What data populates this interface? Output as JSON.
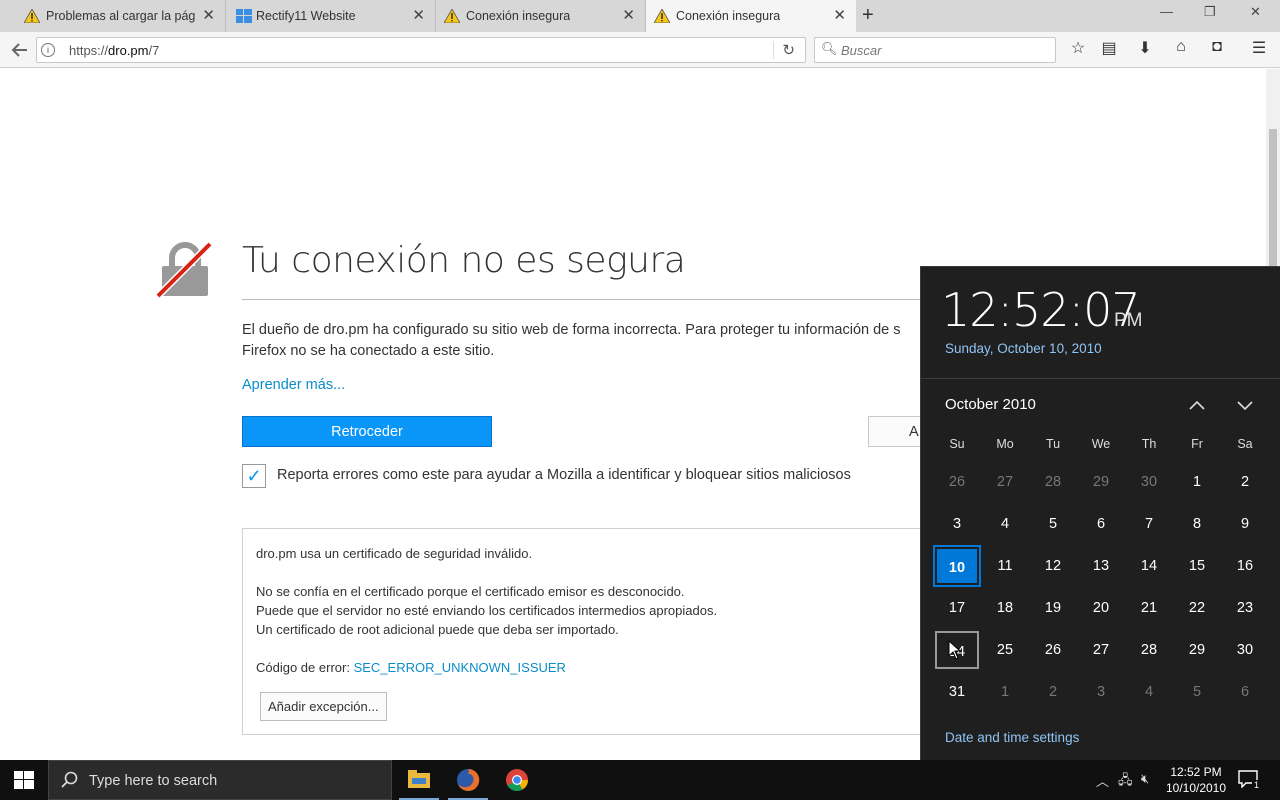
{
  "tabs": [
    {
      "label": "Problemas al cargar la pág...",
      "icon": "warning-icon",
      "active": false
    },
    {
      "label": "Rectify11 Website",
      "icon": "windows-logo-icon",
      "active": false
    },
    {
      "label": "Conexión insegura",
      "icon": "warning-icon",
      "active": false
    },
    {
      "label": "Conexión insegura",
      "icon": "warning-icon",
      "active": true
    }
  ],
  "nav": {
    "url_scheme": "https://",
    "url_host": "dro.pm",
    "url_path": "/7",
    "search_placeholder": "Buscar"
  },
  "error": {
    "title": "Tu conexión no es segura",
    "description": "El dueño de dro.pm ha configurado su sitio web de forma incorrecta. Para proteger tu información de s",
    "description_line2": "Firefox no se ha conectado a este sitio.",
    "learn_more": "Aprender más...",
    "back_button": "Retroceder",
    "advanced_button": "A",
    "report_checkbox_checked": true,
    "report_label": "Reporta errores como este para ayudar a Mozilla a identificar y bloquear sitios maliciosos",
    "cert": {
      "line1": "dro.pm usa un certificado de seguridad inválido.",
      "line2": "No se confía en el certificado porque el certificado emisor es desconocido.",
      "line3": "Puede que el servidor no esté enviando los certificados intermedios apropiados.",
      "line4": "Un certificado de root adicional puede que deba ser importado.",
      "code_label": "Código de error: ",
      "code_value": "SEC_ERROR_UNKNOWN_ISSUER",
      "exception_button": "Añadir excepción..."
    }
  },
  "flyout": {
    "time": "12:52:07",
    "ampm": "PM",
    "date": "Sunday, October 10, 2010",
    "month": "October 2010",
    "weekdays": [
      "Su",
      "Mo",
      "Tu",
      "We",
      "Th",
      "Fr",
      "Sa"
    ],
    "weeks": [
      [
        "26",
        "27",
        "28",
        "29",
        "30",
        "1",
        "2"
      ],
      [
        "3",
        "4",
        "5",
        "6",
        "7",
        "8",
        "9"
      ],
      [
        "10",
        "11",
        "12",
        "13",
        "14",
        "15",
        "16"
      ],
      [
        "17",
        "18",
        "19",
        "20",
        "21",
        "22",
        "23"
      ],
      [
        "24",
        "25",
        "26",
        "27",
        "28",
        "29",
        "30"
      ],
      [
        "31",
        "1",
        "2",
        "3",
        "4",
        "5",
        "6"
      ]
    ],
    "today": "10",
    "hovered": "24",
    "settings_link": "Date and time settings",
    "accent": "#0078d7"
  },
  "taskbar": {
    "search_placeholder": "Type here to search",
    "apps": [
      "file-explorer-icon",
      "firefox-icon",
      "chrome-icon"
    ],
    "clock_time": "12:52 PM",
    "clock_date": "10/10/2010",
    "notification_count": "1"
  }
}
